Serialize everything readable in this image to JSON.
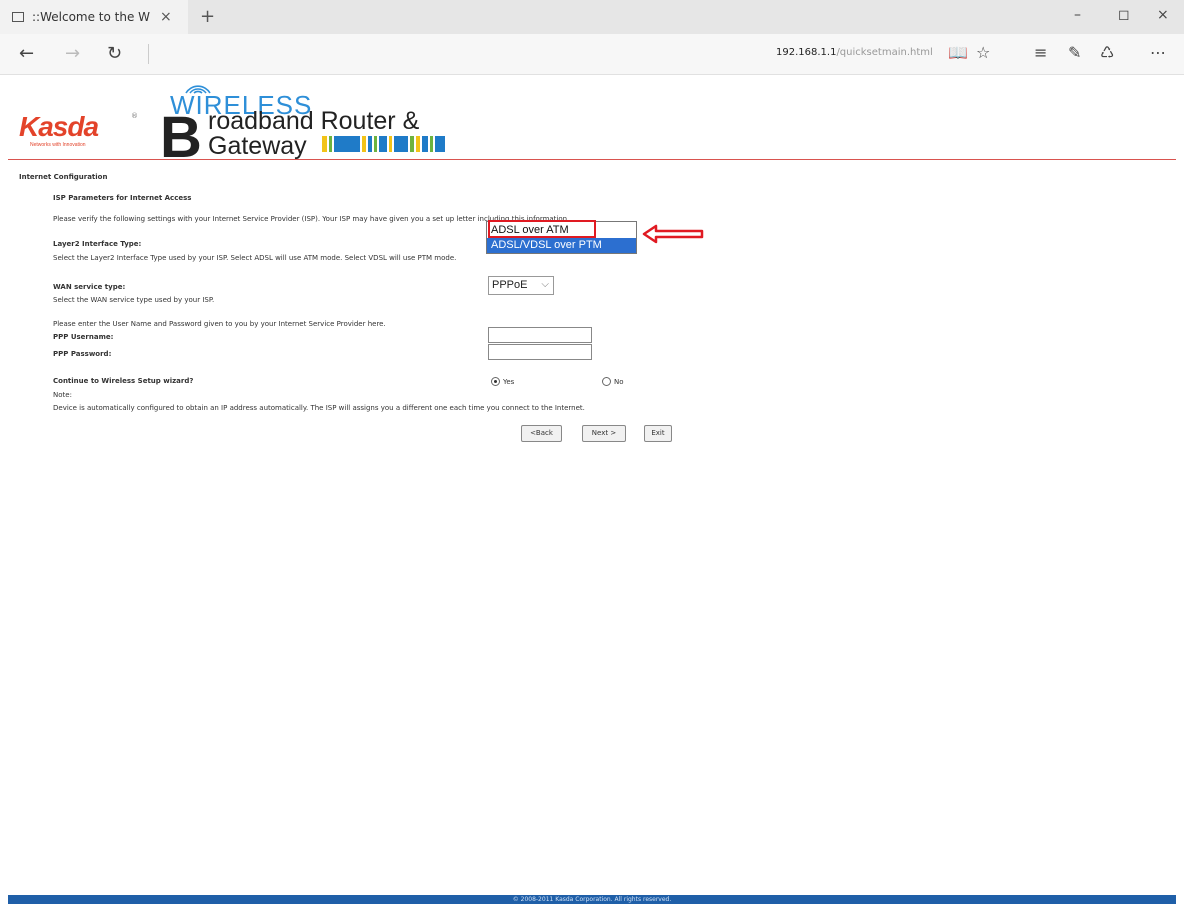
{
  "browser": {
    "tab_title": "::Welcome to the Web-",
    "tab_close": "×",
    "new_tab": "+",
    "win_min": "–",
    "win_max": "◻",
    "win_close": "×",
    "back": "←",
    "forward": "→",
    "refresh": "↻",
    "url_host": "192.168.1.1",
    "url_path": "/quicksetmain.html",
    "reading_view": "📖",
    "favorite": "☆",
    "hub": "≡",
    "note": "✎",
    "share": "♺",
    "more": "⋯"
  },
  "brand": {
    "logo": "Kasda",
    "logo_reg": "®",
    "tagline": "Networks with Innovation",
    "wireless": "WIRELESS",
    "big_letter": "B",
    "line1": "roadband Router &",
    "line2": "Gateway"
  },
  "form": {
    "section_title": "Internet Configuration",
    "isp_heading": "ISP Parameters for Internet Access",
    "isp_desc": "Please verify the following settings with your Internet Service Provider (ISP). Your ISP may have given you a set up letter including this information.",
    "layer2_label": "Layer2 Interface Type:",
    "layer2_desc": "Select the Layer2 Interface Type used by your ISP. Select ADSL will use ATM mode. Select VDSL will use PTM mode.",
    "layer2_options": [
      "ADSL over ATM",
      "ADSL/VDSL over PTM"
    ],
    "wan_label": "WAN service type:",
    "wan_desc": "Select the WAN service type used by your ISP.",
    "wan_value": "PPPoE",
    "wan_chev": "⌵",
    "credentials_desc": "Please enter the User Name and Password given to you by your Internet Service Provider here.",
    "ppp_username_label": "PPP Username:",
    "ppp_password_label": "PPP Password:",
    "ppp_username": "",
    "ppp_password": "",
    "wireless_label": "Continue to Wireless Setup wizard?",
    "radio_yes": "Yes",
    "radio_no": "No",
    "note_label": "Note:",
    "note_text": "Device is automatically configured to obtain an IP address automatically. The ISP will assigns you a different one each time you connect to the Internet.",
    "btn_back": "<Back",
    "btn_next": "Next >",
    "btn_exit": "Exit"
  },
  "footer": {
    "text": "© 2008-2011 Kasda Corporation. All rights reserved."
  },
  "colors": {
    "accent_red": "#e01a22",
    "select_blue": "#2c6fd0",
    "footer_blue": "#1f5fa8",
    "wireless_blue": "#2e8fd8"
  }
}
